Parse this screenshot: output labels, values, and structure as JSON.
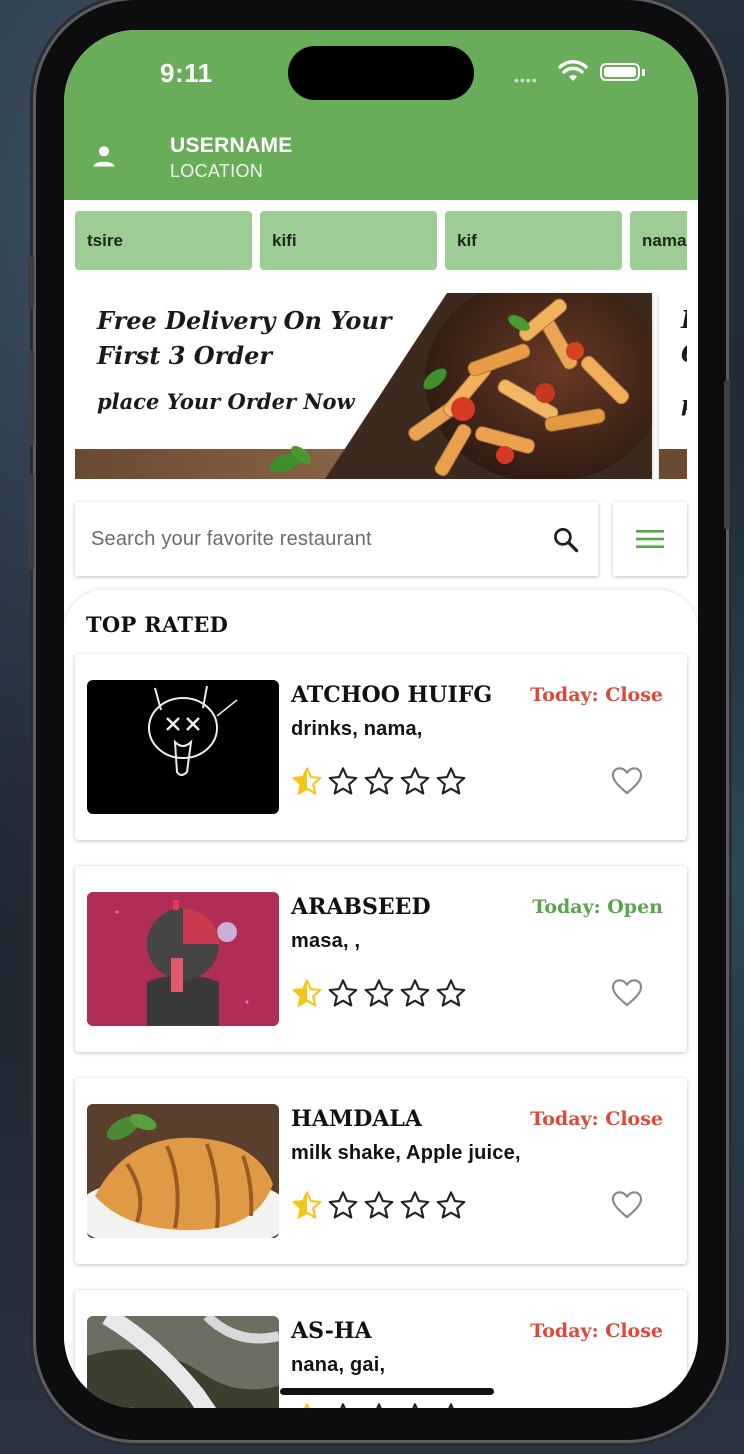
{
  "status": {
    "time": "9:11",
    "dots": "•••• "
  },
  "header": {
    "username": "USERNAME",
    "location": "LOCATION"
  },
  "chips": [
    "tsire",
    "kifi",
    "kif",
    "nama"
  ],
  "banner": {
    "title": "Free Delivery On Your First 3 Order",
    "subtitle": "place Your Order Now",
    "next_peek": [
      "F",
      "O",
      "p"
    ]
  },
  "search": {
    "placeholder": "Search your favorite restaurant"
  },
  "section": {
    "title": "TOP RATED"
  },
  "restaurants": [
    {
      "name": "ATCHOO HUIFG",
      "status": "Today: Close",
      "categories": "drinks,   nama,",
      "rating": 1,
      "status_color": "#e0473a"
    },
    {
      "name": "ARABSEED",
      "status": "Today: Open",
      "categories": "masa,   ,",
      "rating": 1,
      "status_color": "#5aa54b"
    },
    {
      "name": "HAMDALA",
      "status": "Today: Close",
      "categories": "milk shake,   Apple juice,",
      "rating": 1,
      "status_color": "#e0473a"
    },
    {
      "name": "AS-HA",
      "status": "Today: Close",
      "categories": "nana,  gai,",
      "rating": 1,
      "status_color": "#e0473a"
    }
  ],
  "colors": {
    "appbar": "#69ad5a",
    "chip": "#9ecc95",
    "star_filled": "#f5c518",
    "menu_icon": "#5aa54b"
  }
}
